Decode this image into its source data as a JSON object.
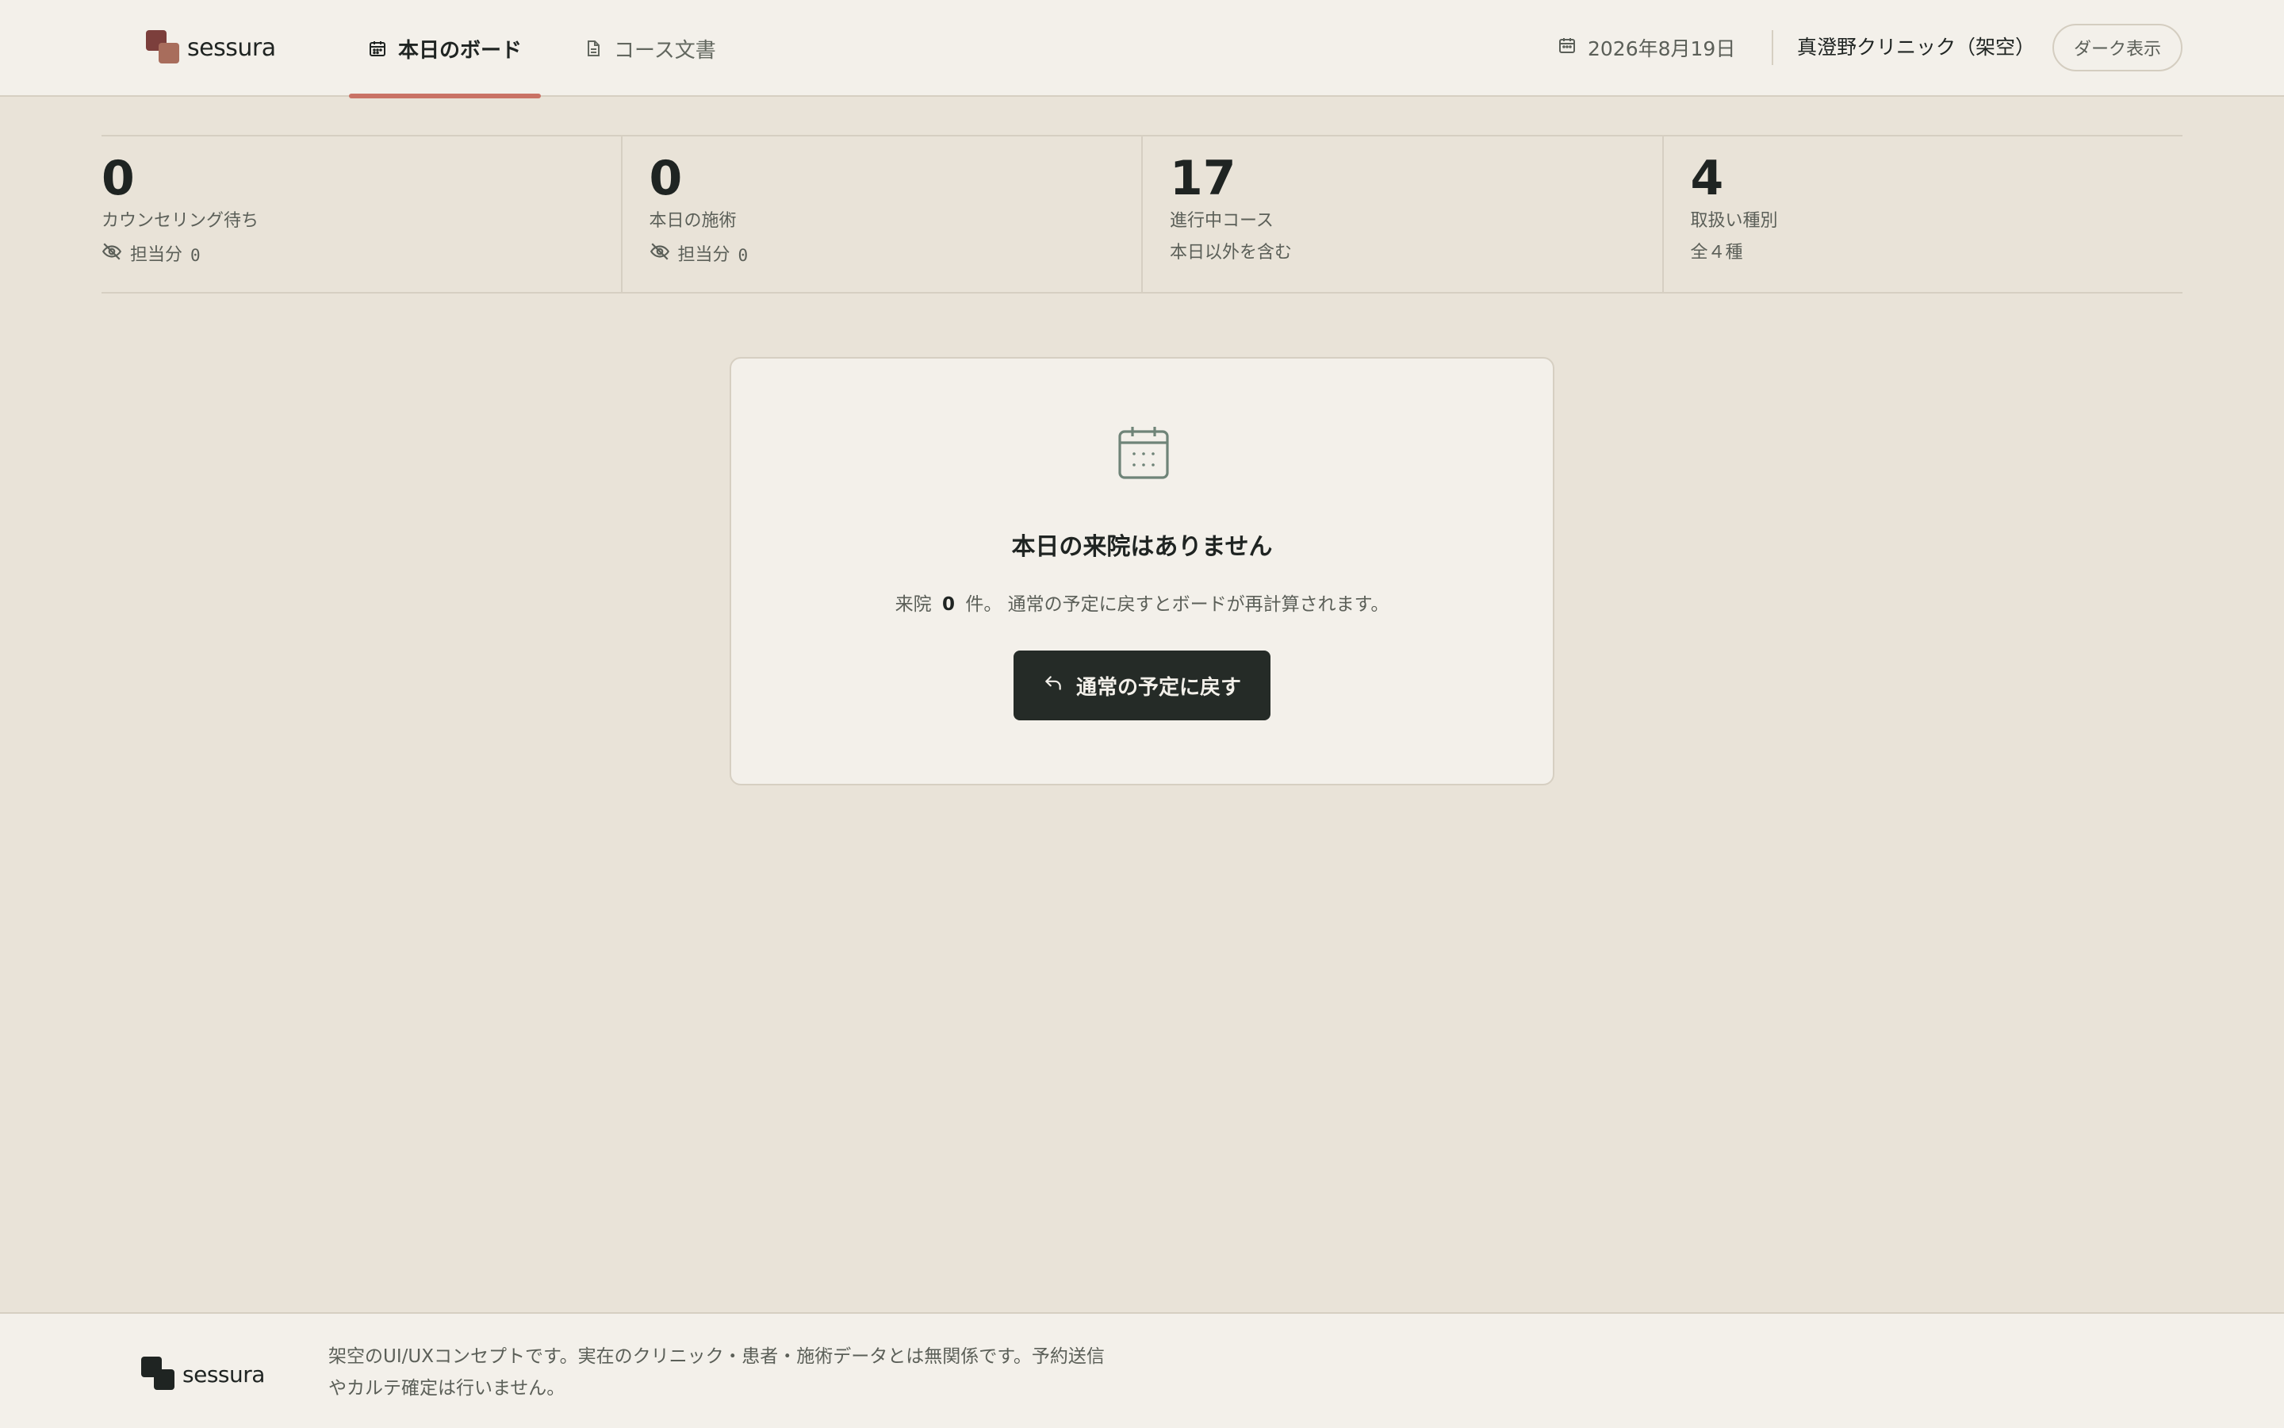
{
  "brand": {
    "name": "sessura",
    "colors": {
      "primary": "#7c3f3c",
      "secondary": "#a86d5c",
      "dark": "#1f2422",
      "accent": "#c97265"
    }
  },
  "nav": {
    "tabs": [
      {
        "label": "本日のボード",
        "icon": "calendar-icon",
        "active": true
      },
      {
        "label": "コース文書",
        "icon": "document-icon",
        "active": false
      }
    ]
  },
  "header": {
    "date": "2026年8月19日",
    "clinic": "真澄野クリニック（架空）",
    "theme_toggle": "ダーク表示"
  },
  "stats": [
    {
      "value": "0",
      "label": "カウンセリング待ち",
      "sub_label": "担当分",
      "sub_value": "0",
      "sub_icon": "eye-off-icon"
    },
    {
      "value": "0",
      "label": "本日の施術",
      "sub_label": "担当分",
      "sub_value": "0",
      "sub_icon": "eye-off-icon"
    },
    {
      "value": "17",
      "label": "進行中コース",
      "sub": "本日以外を含む"
    },
    {
      "value": "4",
      "label": "取扱い種別",
      "sub": "全４種"
    }
  ],
  "empty_state": {
    "icon": "calendar-icon",
    "title": "本日の来院はありません",
    "text_prefix": "来院",
    "count": "0",
    "text_suffix": "件。 通常の予定に戻すとボードが再計算されます。",
    "button_label": "通常の予定に戻す",
    "button_icon": "undo-arrow-icon"
  },
  "footer": {
    "brand": "sessura",
    "disclaimer": "架空のUI/UXコンセプトです。実在のクリニック・患者・施術データとは無関係です。予約送信やカルテ確定は行いません。"
  }
}
